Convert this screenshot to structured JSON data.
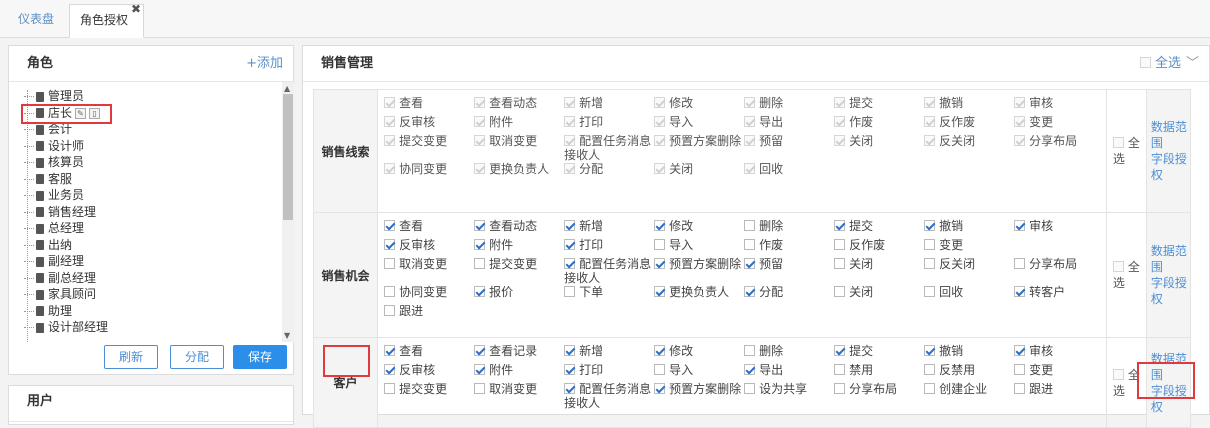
{
  "tabs": [
    {
      "label": "仪表盘"
    },
    {
      "label": "角色授权"
    }
  ],
  "role_panel": {
    "title": "角色",
    "add_label": "+添加",
    "roles": [
      "管理员",
      "店长",
      "会计",
      "设计师",
      "核算员",
      "客服",
      "业务员",
      "销售经理",
      "总经理",
      "出纳",
      "副经理",
      "副总经理",
      "家具顾问",
      "助理",
      "设计部经理"
    ],
    "buttons": {
      "refresh": "刷新",
      "assign": "分配",
      "save": "保存"
    }
  },
  "user_panel": {
    "title": "用户"
  },
  "perm_panel": {
    "title": "销售管理",
    "select_all": "全选",
    "modules": [
      {
        "name": "销售线索",
        "rows": [
          [
            {
              "l": "查看",
              "c": true
            },
            {
              "l": "查看动态",
              "c": true
            },
            {
              "l": "新增",
              "c": true
            },
            {
              "l": "修改",
              "c": true
            },
            {
              "l": "删除",
              "c": true
            },
            {
              "l": "提交",
              "c": true
            },
            {
              "l": "撤销",
              "c": true
            },
            {
              "l": "审核",
              "c": true
            }
          ],
          [
            {
              "l": "反审核",
              "c": true
            },
            {
              "l": "附件",
              "c": true
            },
            {
              "l": "打印",
              "c": true
            },
            {
              "l": "导入",
              "c": true
            },
            {
              "l": "导出",
              "c": true
            },
            {
              "l": "作废",
              "c": true
            },
            {
              "l": "反作废",
              "c": true
            },
            {
              "l": "变更",
              "c": true
            }
          ],
          [
            {
              "l": "提交变更",
              "c": true
            },
            {
              "l": "取消变更",
              "c": true
            },
            {
              "l": "配置任务消息接收人",
              "c": true
            },
            {
              "l": "预置方案删除",
              "c": true
            },
            {
              "l": "预留",
              "c": true
            },
            {
              "l": "关闭",
              "c": true
            },
            {
              "l": "反关闭",
              "c": true
            },
            {
              "l": "分享布局",
              "c": true
            }
          ],
          [
            {
              "l": "协同变更",
              "c": true
            },
            {
              "l": "更换负责人",
              "c": true
            },
            {
              "l": "分配",
              "c": true
            },
            {
              "l": "关闭",
              "c": true
            },
            {
              "l": "回收",
              "c": true
            }
          ]
        ],
        "enabled": false,
        "select_all": "全选",
        "links": [
          "数据范围",
          "字段授权"
        ]
      },
      {
        "name": "销售机会",
        "rows": [
          [
            {
              "l": "查看",
              "c": true
            },
            {
              "l": "查看动态",
              "c": true
            },
            {
              "l": "新增",
              "c": true
            },
            {
              "l": "修改",
              "c": true
            },
            {
              "l": "删除",
              "c": false
            },
            {
              "l": "提交",
              "c": true
            },
            {
              "l": "撤销",
              "c": true
            },
            {
              "l": "审核",
              "c": true
            }
          ],
          [
            {
              "l": "反审核",
              "c": true
            },
            {
              "l": "附件",
              "c": true
            },
            {
              "l": "打印",
              "c": true
            },
            {
              "l": "导入",
              "c": false
            },
            {
              "l": "作废",
              "c": false
            },
            {
              "l": "反作废",
              "c": false
            },
            {
              "l": "变更",
              "c": false
            }
          ],
          [
            {
              "l": "取消变更",
              "c": false
            },
            {
              "l": "提交变更",
              "c": false
            },
            {
              "l": "配置任务消息接收人",
              "c": true
            },
            {
              "l": "预置方案删除",
              "c": true
            },
            {
              "l": "预留",
              "c": true
            },
            {
              "l": "关闭",
              "c": false
            },
            {
              "l": "反关闭",
              "c": false
            },
            {
              "l": "分享布局",
              "c": false
            }
          ],
          [
            {
              "l": "协同变更",
              "c": false
            },
            {
              "l": "报价",
              "c": true
            },
            {
              "l": "下单",
              "c": false
            },
            {
              "l": "更换负责人",
              "c": true
            },
            {
              "l": "分配",
              "c": true
            },
            {
              "l": "关闭",
              "c": false
            },
            {
              "l": "回收",
              "c": false
            },
            {
              "l": "转客户",
              "c": true
            }
          ],
          [
            {
              "l": "跟进",
              "c": false
            }
          ]
        ],
        "select_all": "全选",
        "links": [
          "数据范围",
          "字段授权"
        ]
      },
      {
        "name": "客户",
        "rows": [
          [
            {
              "l": "查看",
              "c": true
            },
            {
              "l": "查看记录",
              "c": true
            },
            {
              "l": "新增",
              "c": true
            },
            {
              "l": "修改",
              "c": true
            },
            {
              "l": "删除",
              "c": false
            },
            {
              "l": "提交",
              "c": true
            },
            {
              "l": "撤销",
              "c": true
            },
            {
              "l": "审核",
              "c": true
            }
          ],
          [
            {
              "l": "反审核",
              "c": true
            },
            {
              "l": "附件",
              "c": true
            },
            {
              "l": "打印",
              "c": true
            },
            {
              "l": "导入",
              "c": false
            },
            {
              "l": "导出",
              "c": true
            },
            {
              "l": "禁用",
              "c": false
            },
            {
              "l": "反禁用",
              "c": false
            },
            {
              "l": "变更",
              "c": false
            }
          ],
          [
            {
              "l": "提交变更",
              "c": false
            },
            {
              "l": "取消变更",
              "c": false
            },
            {
              "l": "配置任务消息接收人",
              "c": true
            },
            {
              "l": "预置方案删除",
              "c": true
            },
            {
              "l": "设为共享",
              "c": false
            },
            {
              "l": "分享布局",
              "c": false
            },
            {
              "l": "创建企业",
              "c": false
            },
            {
              "l": "跟进",
              "c": false
            }
          ]
        ],
        "select_all": "全选",
        "links": [
          "数据范围",
          "字段授权"
        ]
      }
    ]
  },
  "colors": {
    "accent": "#2b8fea",
    "highlight": "#e0393e",
    "link": "#4a8fd6"
  }
}
